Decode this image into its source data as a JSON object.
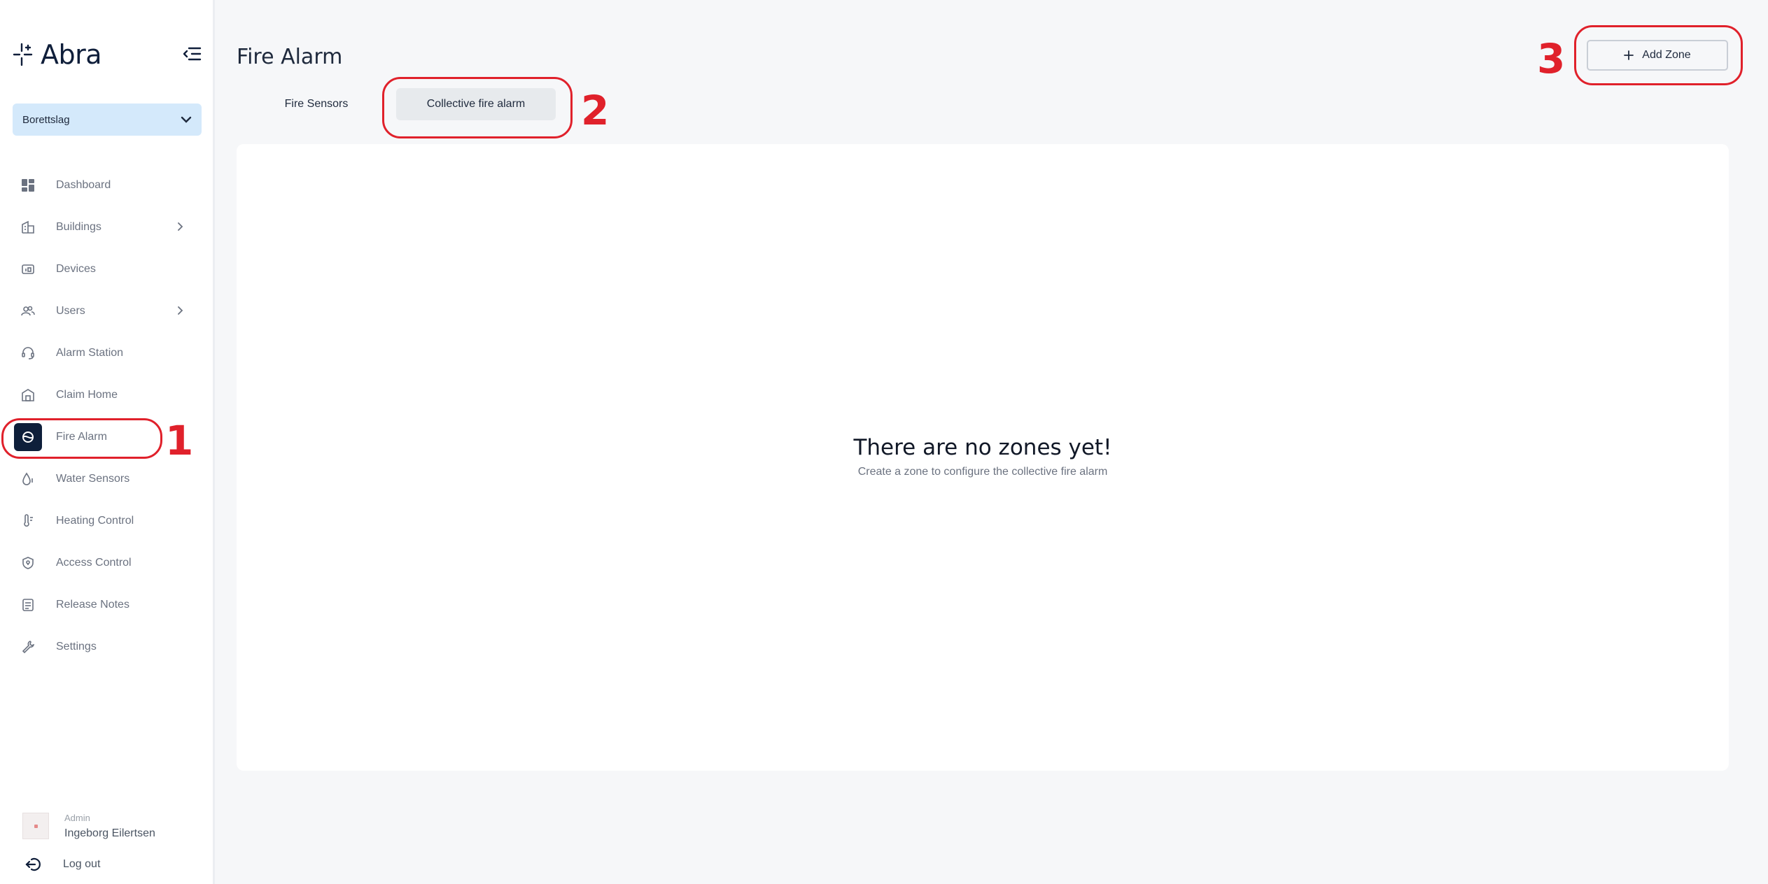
{
  "app": {
    "name": "Abra"
  },
  "sidebar": {
    "org_selector": {
      "value": "Borettslag"
    },
    "items": [
      {
        "label": "Dashboard",
        "icon": "dashboard-icon"
      },
      {
        "label": "Buildings",
        "icon": "building-icon"
      },
      {
        "label": "Devices",
        "icon": "devices-icon"
      },
      {
        "label": "Users",
        "icon": "users-icon"
      },
      {
        "label": "Alarm Station",
        "icon": "headset-icon"
      },
      {
        "label": "Claim Home",
        "icon": "home-icon"
      },
      {
        "label": "Fire Alarm",
        "icon": "fire-alarm-icon",
        "active": true
      },
      {
        "label": "Water Sensors",
        "icon": "water-drop-icon"
      },
      {
        "label": "Heating Control",
        "icon": "thermometer-icon"
      },
      {
        "label": "Access Control",
        "icon": "shield-icon"
      },
      {
        "label": "Release Notes",
        "icon": "notes-icon"
      },
      {
        "label": "Settings",
        "icon": "wrench-icon"
      }
    ],
    "user": {
      "role": "Admin",
      "name": "Ingeborg Eilertsen"
    },
    "logout_label": "Log out"
  },
  "header": {
    "title": "Fire Alarm",
    "add_button_label": "Add Zone"
  },
  "tabs": [
    {
      "label": "Fire Sensors",
      "active": false
    },
    {
      "label": "Collective fire alarm",
      "active": true
    }
  ],
  "empty_state": {
    "title": "There are no zones yet!",
    "subtitle": "Create a zone to configure the collective fire alarm"
  },
  "annotations": [
    "1",
    "2",
    "3"
  ],
  "colors": {
    "accent": "#0e1f3a",
    "selector_bg": "#d4e9fb",
    "annotation": "#e0212b"
  }
}
